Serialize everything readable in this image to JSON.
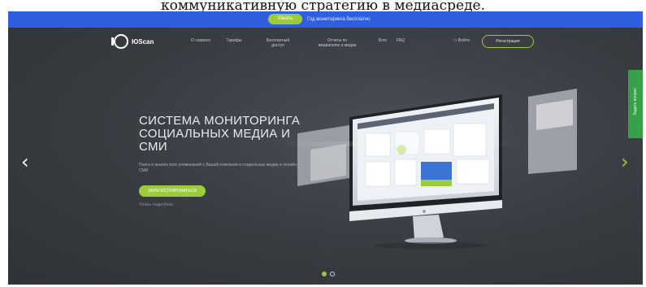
{
  "document": {
    "caption": "коммуникативную стратегию в медиасреде."
  },
  "promo_bar": {
    "badge": "Узнать",
    "text": "Год мониторинга бесплатно"
  },
  "header": {
    "logo_text": "ЮScan",
    "nav": [
      {
        "label": "О сервисе"
      },
      {
        "label": "Тарифы"
      },
      {
        "label": "Бесплатный доступ"
      },
      {
        "label": "Отчеты по медиаполю и медиа"
      },
      {
        "label": "Блог"
      },
      {
        "label": "FAQ"
      }
    ],
    "login": "Войти",
    "register": "Регистрация"
  },
  "hero": {
    "headline": "СИСТЕМА МОНИТОРИНГА СОЦИАЛЬНЫХ МЕДИА И СМИ",
    "subtext": "Поиск и анализ всех упоминаний о Вашей компании в социальных медиа и онлайн-СМИ",
    "cta": "ЗАРЕГИСТРИРОВАТЬСЯ",
    "link": "Узнать подробнее",
    "side_tab": "Задать вопрос"
  },
  "carousel": {
    "prev_icon": "chevron-left-icon",
    "next_icon": "chevron-right-icon",
    "slides": 2,
    "active": 1
  },
  "colors": {
    "accent": "#9ccc3c",
    "topbar": "#2d5fe0",
    "background": "#3a3d42",
    "side_tab": "#37a04a"
  }
}
